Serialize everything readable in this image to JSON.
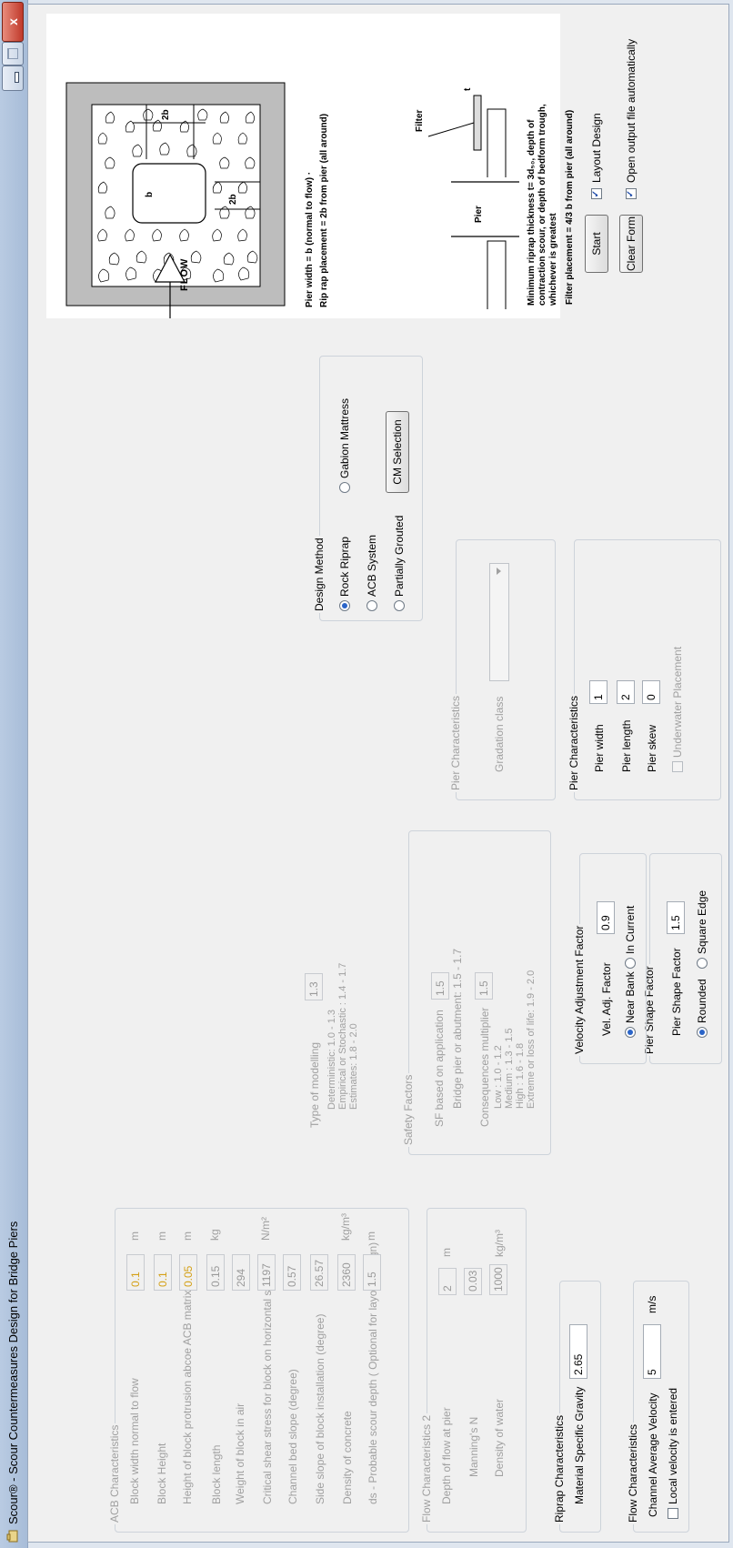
{
  "window": {
    "title": "Scour® - Scour Countermeasures Design for Bridge Piers",
    "close_label": "x"
  },
  "flow": {
    "title": "Flow Characteristics",
    "velocity_label": "Channel Average Velocity",
    "velocity_value": "5",
    "velocity_unit": "m/s",
    "local_velocity_label": "Local velocity is entered"
  },
  "riprap": {
    "title": "Riprap Characteristics",
    "sg_label": "Material Specific Gravity",
    "sg_value": "2.65"
  },
  "flow2": {
    "title": "Flow Characteristics 2",
    "depth_label": "Depth of flow at pier",
    "depth_value": "2",
    "depth_unit": "m",
    "manning_label": "Manning's N",
    "manning_value": "0.03",
    "density_label": "Density of water",
    "density_value": "1000",
    "density_unit": "kg/m³"
  },
  "acb": {
    "title": "ACB Characteristics",
    "rows": [
      {
        "label": "Block width normal to flow",
        "value": "0.1",
        "unit": "m"
      },
      {
        "label": "Block Height",
        "value": "0.1",
        "unit": "m"
      },
      {
        "label": "Height of block protrusion abcoe ACB matrix",
        "value": "0.05",
        "unit": "m"
      },
      {
        "label": "Block length",
        "value": "0.15",
        "unit": "kg"
      },
      {
        "label": "Weight of block in air",
        "value": "294",
        "unit": ""
      },
      {
        "label": "Critical shear stress for block on horizontal surface",
        "value": "1197",
        "unit": "N/m²"
      },
      {
        "label": "Channel bed slope (degree)",
        "value": "0.57",
        "unit": ""
      },
      {
        "label": "Side slope of block  installation (degree)",
        "value": "26.57",
        "unit": ""
      },
      {
        "label": "Density of concrete",
        "value": "2360",
        "unit": "kg/m³"
      },
      {
        "label": "ds - Probable scour depth ( Optional for layout design)",
        "value": "1.5",
        "unit": "m"
      }
    ]
  },
  "pier_shape": {
    "title": "Pier Shape Factor",
    "factor_label": "Pier Shape Factor",
    "factor_value": "1.5",
    "rounded_label": "Rounded",
    "square_label": "Square Edge"
  },
  "velocity_adj": {
    "title": "Velocity Adjustment Factor",
    "factor_label": "Vel. Adj. Factor",
    "factor_value": "0.9",
    "near_bank_label": "Near Bank",
    "in_current_label": "In Current"
  },
  "safety": {
    "title": "Safety Factors",
    "sf_label": "SF based on application",
    "sf_value": "1.5",
    "sf_note": "Bridge pier or abutment: 1.5 - 1.7",
    "cons_label": "Consequences multiplier",
    "cons_value": "1.5",
    "cons_notes": [
      "Low : 1.0 - 1.2",
      "Medium : 1.3 - 1.5",
      "High : 1.6 - 1.8",
      "Extreme or loss of life: 1.9 - 2.0"
    ],
    "model_label": "Type of modelling",
    "model_value": "1.3",
    "model_notes": [
      "Deterministic: 1.0 - 1.3",
      "Empirical or Stochastic : 1.4 - 1.7",
      "Estimates: 1.8 - 2.0"
    ]
  },
  "pier_char": {
    "title": "Pier Characteristics",
    "width_label": "Pier width",
    "width_value": "1",
    "length_label": "Pier length",
    "length_value": "2",
    "skew_label": "Pier skew",
    "skew_value": "0",
    "underwater_label": "Underwater Placement"
  },
  "pier_char2": {
    "title": "Pier Characteristics",
    "gradation_label": "Gradation class"
  },
  "design": {
    "title": "Design Method",
    "rock_label": "Rock Riprap",
    "acb_label": "ACB System",
    "partial_label": "Partially Grouted",
    "gabion_label": "Gabion Mattress",
    "cm_button": "CM Selection"
  },
  "diagram": {
    "flow_label": "FLOW",
    "b_label": "b",
    "two_b_label": "2b",
    "pier_width_text": "Pier width = b    (normal to flow) ·",
    "riprap_placement_text": "Rip rap placement = 2b    from pier (all around)",
    "pier_label": "Pier",
    "filter_label": "Filter",
    "t_label": "t",
    "min_thickness_lines": [
      "Minimum riprap thickness t= 3d₅₀, depth of",
      "contraction scour, or depth of bedform trough,",
      "whichever is greatest"
    ],
    "filter_placement_text": "Filter placement = 4/3 b  from pier (all around)"
  },
  "actions": {
    "start_label": "Start",
    "clear_label": "Clear Form",
    "layout_label": "Layout Design",
    "open_output_label": "Open output file automatically"
  }
}
